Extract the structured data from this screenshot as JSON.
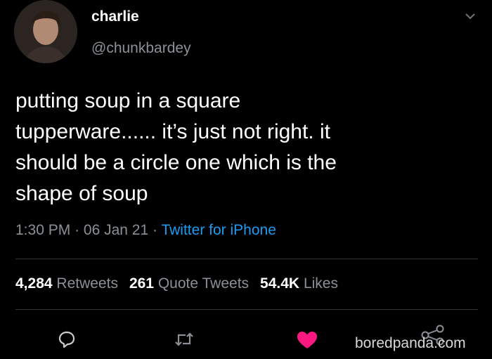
{
  "author": {
    "name": "charlie",
    "handle": "@chunkbardey"
  },
  "tweet": {
    "lines": [
      "putting soup in a square",
      "tupperware...... it’s just not right. it",
      "should be a circle one which is the",
      "shape of soup"
    ],
    "time": "1:30 PM",
    "date": "06 Jan 21",
    "separator": "·",
    "source": "Twitter for iPhone"
  },
  "stats": {
    "retweets_count": "4,284",
    "retweets_label": "Retweets",
    "quotes_count": "261",
    "quotes_label": "Quote Tweets",
    "likes_count": "54.4K",
    "likes_label": "Likes"
  },
  "icons": {
    "reply": "reply-icon",
    "retweet": "retweet-icon",
    "like": "heart-icon",
    "share": "share-icon",
    "menu": "chevron-down-icon"
  },
  "colors": {
    "link": "#1d9bf0",
    "like": "#f91880",
    "muted": "#8b9096"
  },
  "watermark": "boredpanda.com"
}
